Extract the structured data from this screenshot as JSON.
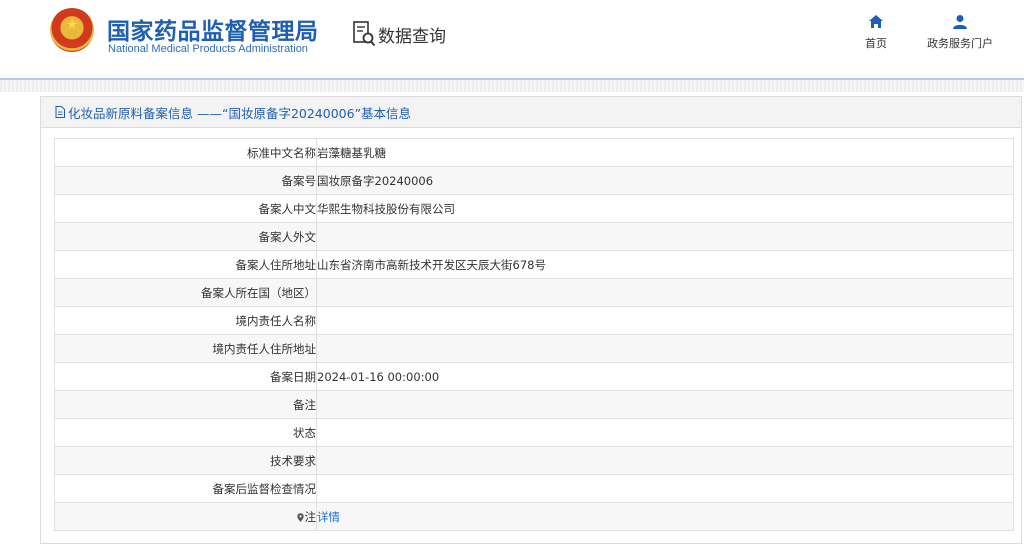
{
  "header": {
    "brand_cn": "国家药品监督管理局",
    "brand_en": "National Medical Products Administration",
    "query_label": "数据查询",
    "nav": {
      "home_label": "首页",
      "gov_portal_label": "政务服务门户"
    }
  },
  "panel": {
    "title": "化妆品新原料备案信息 ——“国妆原备字20240006”基本信息"
  },
  "rows": [
    {
      "label": "标准中文名称",
      "value": "岩藻糖基乳糖"
    },
    {
      "label": "备案号",
      "value": "国妆原备字20240006"
    },
    {
      "label": "备案人中文",
      "value": "华熙生物科技股份有限公司"
    },
    {
      "label": "备案人外文",
      "value": ""
    },
    {
      "label": "备案人住所地址",
      "value": "山东省济南市高新技术开发区天辰大街678号"
    },
    {
      "label": "备案人所在国（地区）",
      "value": ""
    },
    {
      "label": "境内责任人名称",
      "value": ""
    },
    {
      "label": "境内责任人住所地址",
      "value": ""
    },
    {
      "label": "备案日期",
      "value": "2024-01-16 00:00:00"
    },
    {
      "label": "备注",
      "value": ""
    },
    {
      "label": "状态",
      "value": ""
    },
    {
      "label": "技术要求",
      "value": ""
    },
    {
      "label": "备案后监督检查情况",
      "value": ""
    },
    {
      "label": "注",
      "value": "详情"
    }
  ],
  "colors": {
    "brand_blue": "#1f5fb2",
    "link_blue": "#1f6fd1"
  },
  "icons": {
    "home": "home-icon",
    "user": "user-icon",
    "query": "document-search-icon",
    "note": "map-pin-icon"
  }
}
